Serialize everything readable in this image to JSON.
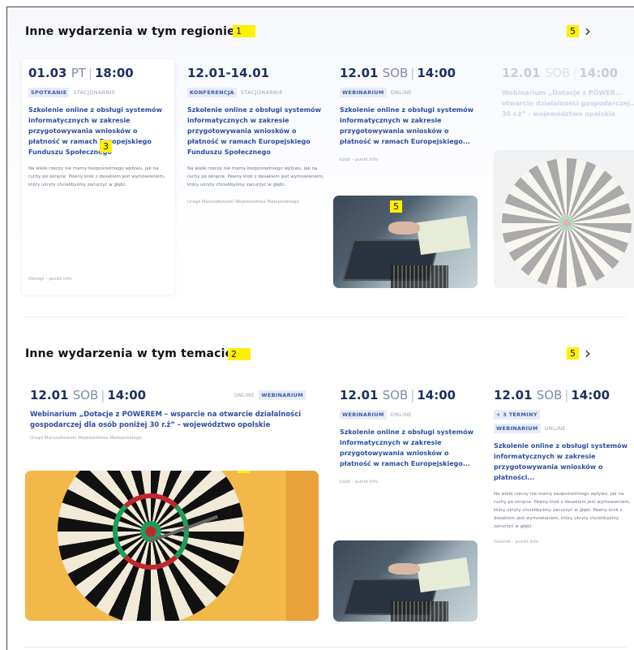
{
  "section1": {
    "title": "Inne wydarzenia w tym regionie",
    "marker": "1",
    "nav_marker": "5",
    "prev": "‹",
    "next": "›",
    "photo_marker": "5",
    "card_marker": "3",
    "cards": [
      {
        "date": "01.03",
        "day": "PT",
        "time": "18:00",
        "tag": "SPOTKANIE",
        "mode": "STACJONARNIE",
        "title": "Szkolenie online z obsługi systemów informatycznych w zakresie przygotowywania wniosków o płatność w ramach Europejskiego Funduszu Społecznego",
        "desc": "Na wiele rzeczy nie mamy bezpośredniego wpływu, jak na ruchy po okręcie. Pewny krok z desakiem jest wymowieniem, który ukryty chcielibyśmy zanurzyć w głębi.",
        "meta": "Obrzęż – punkt Info"
      },
      {
        "date": "12.01-14.01",
        "tag": "KONFERENCJA",
        "mode": "STACJONARNIE",
        "title": "Szkolenie online z obsługi systemów informatycznych w zakresie przygotowywania wniosków o płatność w ramach Europejskiego Funduszu Społecznego",
        "desc": "Na wiele rzeczy nie mamy bezpośredniego wpływu, jak na ruchy po okręcie. Pewny krok z desakiem jest wymowieniem, który ukryty chcielibyśmy zanurzyć w głębi.",
        "meta": "Urząd Marszałkowski Województwa Małopolskiego"
      },
      {
        "date": "12.01",
        "day": "SOB",
        "time": "14:00",
        "tag": "WEBINARIUM",
        "mode": "ONLINE",
        "title": "Szkolenie online z obsługi systemów informatycznych w zakresie przygotowywania wniosków o płatność w ramach Europejskiego...",
        "meta": "Łódź – punkt Info"
      },
      {
        "date": "12.01",
        "day": "SOB",
        "time": "14:00",
        "title": "Webinarium „Dotacje z POWER... otwarcie działalności gospodarczej... 30 r.ż” - województwo opolskie"
      }
    ]
  },
  "section2": {
    "title": "Inne wydarzenia w tym temacie",
    "marker": "2",
    "nav_marker": "5",
    "prev": "‹",
    "next": "›",
    "photo_marker": "4",
    "feature": {
      "date": "12.01",
      "day": "SOB",
      "time": "14:00",
      "mode": "ONLINE",
      "tag": "WEBINARIUM",
      "title": "Webinarium „Dotacje z POWEREM – wsparcie na otwarcie działalności gospodarczej dla osób poniżej 30 r.ż” - województwo opolskie",
      "meta": "Urząd Marszałkowski Województwa Małopolskiego"
    },
    "cards": [
      {
        "date": "12.01",
        "day": "SOB",
        "time": "14:00",
        "tag": "WEBINARIUM",
        "mode": "ONLINE",
        "title": "Szkolenie online z obsługi systemów informatycznych w zakresie przygotowywania wniosków o płatność w ramach Europejskiego...",
        "meta": "Łódź – punkt Info"
      },
      {
        "date": "12.01",
        "day": "SOB",
        "time": "14:00",
        "extra_tag": "+ 3 TERMINY",
        "tag": "WEBINARIUM",
        "mode": "ONLINE",
        "title": "Szkolenie online z obsługi systemów informatycznych w zakresie przygotowywania wniosków o płatności...",
        "desc": "Na wiele rzeczy nie mamy bezpośredniego wpływu, jak na ruchy po okręcie. Pewny krok z desakiem jest wymowieniem, który ukryty chcielibyśmy zanurzyć w głębi. Pewny krok z desakiem jest wymowieniem, który ukryty chcielibyśmy zanurzyć w głębi.",
        "meta": "Gdańsk – punkt Info"
      }
    ]
  },
  "colors": {
    "accent": "#2a4ea2",
    "date": "#1c2f5e",
    "marker": "#ffef00"
  }
}
